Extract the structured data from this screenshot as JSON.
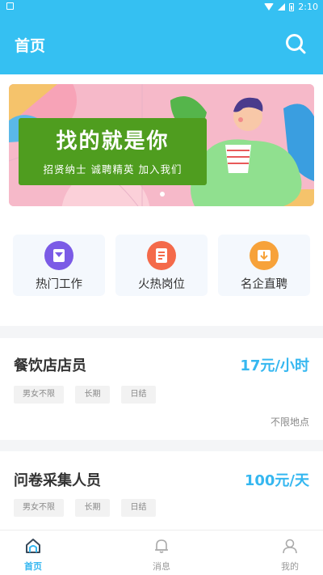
{
  "status_bar": {
    "time": "2:10",
    "battery_icon": "battery-icon",
    "wifi_icon": "wifi-icon",
    "signal_icon": "signal-icon"
  },
  "app_bar": {
    "title": "首页",
    "search_icon": "search-icon"
  },
  "banner": {
    "headline": "找的就是你",
    "subline": "招贤纳士 诚聘精英 加入我们"
  },
  "shortcuts": [
    {
      "label": "热门工作",
      "icon": "hot-jobs-icon",
      "color": "#7b5be6"
    },
    {
      "label": "火热岗位",
      "icon": "popular-positions-icon",
      "color": "#f46a4a"
    },
    {
      "label": "名企直聘",
      "icon": "famous-company-icon",
      "color": "#f7a23a"
    }
  ],
  "jobs": [
    {
      "title": "餐饮店店员",
      "salary": "17元/小时",
      "tags": [
        "男女不限",
        "长期",
        "日结"
      ],
      "location": "不限地点"
    },
    {
      "title": "问卷采集人员",
      "salary": "100元/天",
      "tags": [
        "男女不限",
        "长期",
        "日结"
      ],
      "location": ""
    }
  ],
  "tab_bar": {
    "tabs": [
      {
        "label": "首页",
        "icon": "home-icon",
        "active": true
      },
      {
        "label": "消息",
        "icon": "bell-icon",
        "active": false
      },
      {
        "label": "我的",
        "icon": "user-icon",
        "active": false
      }
    ]
  },
  "colors": {
    "primary": "#35c0f2",
    "accent": "#35b7f0"
  }
}
